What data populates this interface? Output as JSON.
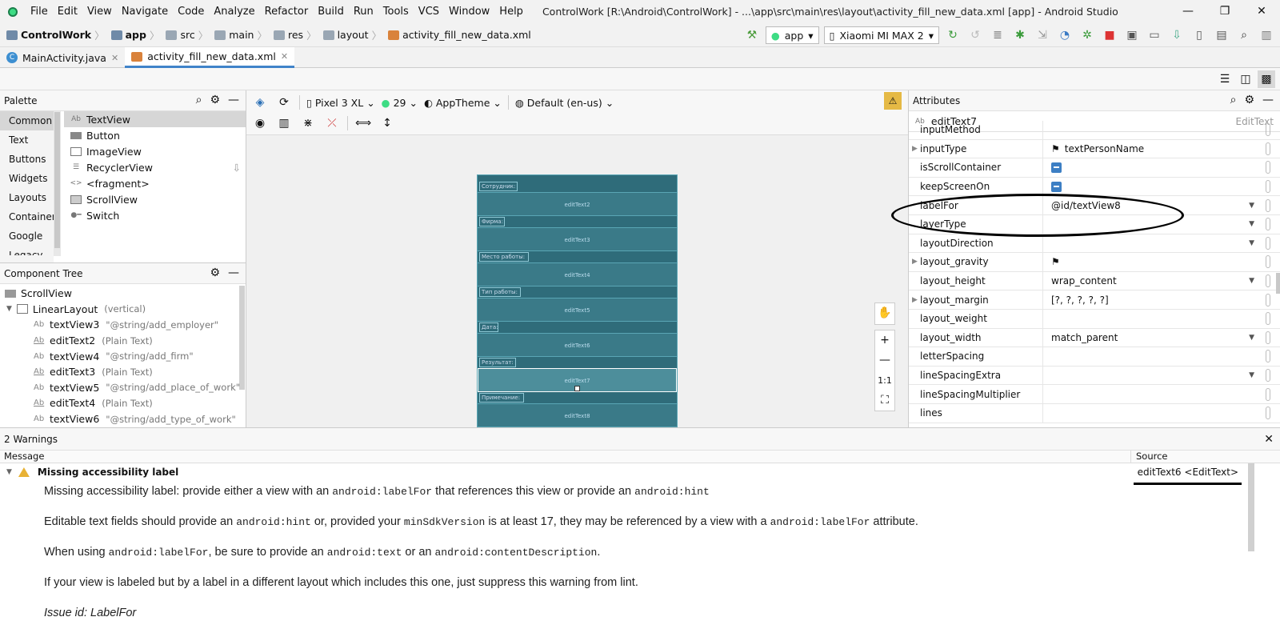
{
  "window": {
    "title": "ControlWork [R:\\Android\\ControlWork] - ...\\app\\src\\main\\res\\layout\\activity_fill_new_data.xml [app] - Android Studio",
    "menu": [
      "File",
      "Edit",
      "View",
      "Navigate",
      "Code",
      "Analyze",
      "Refactor",
      "Build",
      "Run",
      "Tools",
      "VCS",
      "Window",
      "Help"
    ],
    "controls": {
      "minimize": "—",
      "maximize": "❐",
      "close": "✕"
    }
  },
  "breadcrumb": [
    "ControlWork",
    "app",
    "src",
    "main",
    "res",
    "layout",
    "activity_fill_new_data.xml"
  ],
  "toolbar": {
    "run_config": "app",
    "device": "Xiaomi MI MAX 2"
  },
  "tabs": [
    {
      "label": "MainActivity.java",
      "active": false
    },
    {
      "label": "activity_fill_new_data.xml",
      "active": true
    }
  ],
  "palette": {
    "title": "Palette",
    "categories": [
      "Common",
      "Text",
      "Buttons",
      "Widgets",
      "Layouts",
      "Container",
      "Google",
      "Legacy"
    ],
    "widgets": [
      "TextView",
      "Button",
      "ImageView",
      "RecyclerView",
      "<fragment>",
      "ScrollView",
      "Switch"
    ],
    "textview_icon": "Ab",
    "fragment_icon": "<>"
  },
  "design_toolbar": {
    "device": "Pixel 3 XL",
    "api": "29",
    "theme": "AppTheme",
    "locale": "Default (en-us)"
  },
  "zoom": {
    "plus": "+",
    "minus": "—",
    "one_to_one": "1:1"
  },
  "preview": {
    "labels": [
      "Сотрудник:",
      "Фирма:",
      "Место работы:",
      "Тип работы:",
      "Дата:",
      "Результат:",
      "Примечание:"
    ],
    "edits": [
      "editText2",
      "editText3",
      "editText4",
      "editText5",
      "editText6",
      "editText7",
      "editText8"
    ]
  },
  "component_tree": {
    "title": "Component Tree",
    "rows": [
      {
        "name": "ScrollView",
        "detail": "",
        "level": 0
      },
      {
        "name": "LinearLayout",
        "detail": "(vertical)",
        "level": 1
      },
      {
        "name": "textView3",
        "detail": "\"@string/add_employer\"",
        "level": 2
      },
      {
        "name": "editText2",
        "detail": "(Plain Text)",
        "level": 2
      },
      {
        "name": "textView4",
        "detail": "\"@string/add_firm\"",
        "level": 2
      },
      {
        "name": "editText3",
        "detail": "(Plain Text)",
        "level": 2
      },
      {
        "name": "textView5",
        "detail": "\"@string/add_place_of_work\"",
        "level": 2
      },
      {
        "name": "editText4",
        "detail": "(Plain Text)",
        "level": 2
      },
      {
        "name": "textView6",
        "detail": "\"@string/add_type_of_work\"",
        "level": 2
      }
    ]
  },
  "attributes": {
    "title": "Attributes",
    "selected": "editText7",
    "selected_class": "EditText",
    "rows": [
      {
        "name": "inputMethod",
        "value": ""
      },
      {
        "name": "inputType",
        "value": "textPersonName"
      },
      {
        "name": "isScrollContainer",
        "value": ""
      },
      {
        "name": "keepScreenOn",
        "value": ""
      },
      {
        "name": "labelFor",
        "value": "@id/textView8"
      },
      {
        "name": "layerType",
        "value": ""
      },
      {
        "name": "layoutDirection",
        "value": ""
      },
      {
        "name": "layout_gravity",
        "value": ""
      },
      {
        "name": "layout_height",
        "value": "wrap_content"
      },
      {
        "name": "layout_margin",
        "value": "[?, ?, ?, ?, ?]"
      },
      {
        "name": "layout_weight",
        "value": ""
      },
      {
        "name": "layout_width",
        "value": "match_parent"
      },
      {
        "name": "letterSpacing",
        "value": ""
      },
      {
        "name": "lineSpacingExtra",
        "value": ""
      },
      {
        "name": "lineSpacingMultiplier",
        "value": ""
      },
      {
        "name": "lines",
        "value": ""
      }
    ]
  },
  "warnings": {
    "title": "2 Warnings",
    "col_message": "Message",
    "col_source": "Source",
    "issue_title": "Missing accessibility label",
    "source": "editText6 <EditText>",
    "p1": [
      "Missing accessibility label: provide either a view with an ",
      "android:labelFor",
      " that references this view or provide an ",
      "android:hint"
    ],
    "p2": [
      "Editable text fields should provide an ",
      "android:hint",
      " or, provided your ",
      "minSdkVersion",
      " is at least 17, they may be referenced by a view with a ",
      "android:labelFor",
      " attribute."
    ],
    "p3": [
      "When using ",
      "android:labelFor",
      ", be sure to provide an ",
      "android:text",
      " or an ",
      "android:contentDescription",
      "."
    ],
    "p4": "If your view is labeled but by a label in a different layout which includes this one, just suppress this warning from lint.",
    "issue_id": "Issue id: LabelFor"
  },
  "colors": {
    "accent": "#4083c9",
    "preview_bg": "#2f6c7a",
    "warning": "#e8b235"
  }
}
